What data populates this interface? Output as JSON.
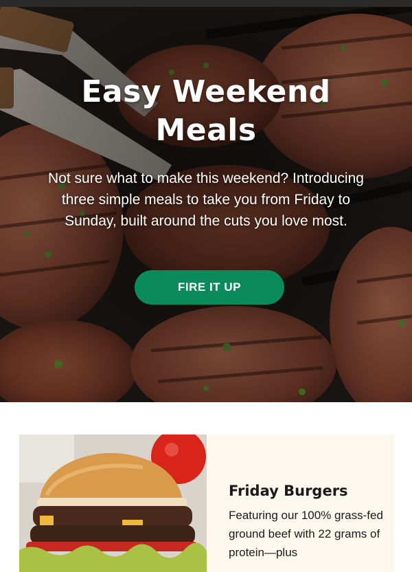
{
  "hero": {
    "title_line1": "Easy Weekend",
    "title_line2": "Meals",
    "subtitle": "Not sure what to make this weekend? Introducing three simple meals to take you from Friday to Sunday, built around the cuts you love most.",
    "cta_label": "FIRE IT UP",
    "cta_color": "#0b8a5c"
  },
  "meals": [
    {
      "title": "Friday Burgers",
      "description": "Featuring our 100% grass-fed ground beef with 22 grams of protein—plus"
    }
  ],
  "colors": {
    "card_background": "#fcf8ee",
    "top_bar": "#2b2b2b"
  }
}
